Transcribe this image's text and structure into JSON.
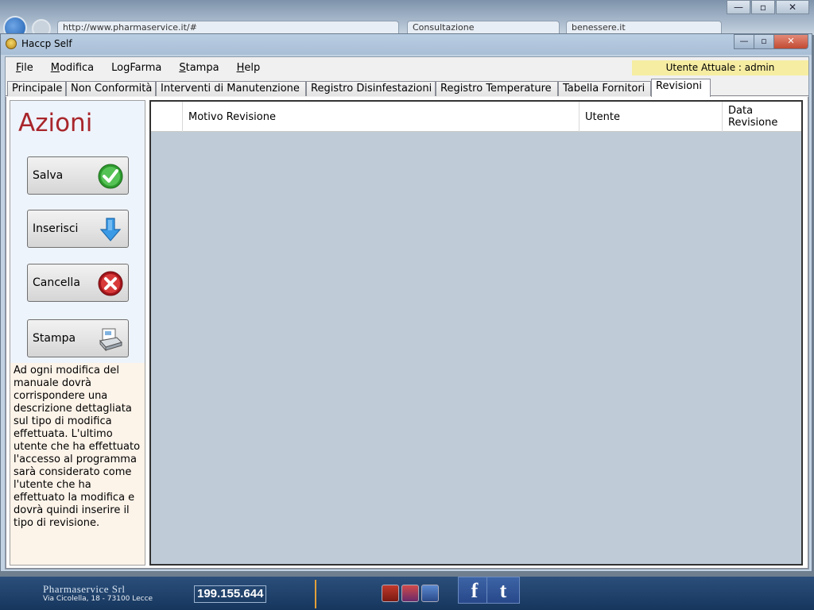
{
  "background": {
    "address_fragment": "http://www.pharmaservice.it/#",
    "tabs": [
      "Consultazione",
      "benessere.it"
    ],
    "controls": [
      "—",
      "▫",
      "✕"
    ]
  },
  "window": {
    "title": "Haccp Self",
    "controls": {
      "minimize": "—",
      "maximize": "▫",
      "close": "✕"
    }
  },
  "menu": {
    "items": [
      {
        "label": "File",
        "mnemonic": "F",
        "rest": "ile"
      },
      {
        "label": "Modifica",
        "mnemonic": "M",
        "rest": "odifica"
      },
      {
        "label": "LogFarma",
        "mnemonic": "",
        "rest": "LogFarma"
      },
      {
        "label": "Stampa",
        "mnemonic": "S",
        "rest": "tampa"
      },
      {
        "label": "Help",
        "mnemonic": "H",
        "rest": "elp"
      }
    ],
    "user_label": "Utente Attuale : admin"
  },
  "tabs": [
    {
      "label": "Principale",
      "active": false
    },
    {
      "label": "Non Conformità",
      "active": false
    },
    {
      "label": "Interventi di Manutenzione",
      "active": false
    },
    {
      "label": "Registro Disinfestazioni",
      "active": false
    },
    {
      "label": "Registro Temperature",
      "active": false
    },
    {
      "label": "Tabella Fornitori",
      "active": false
    },
    {
      "label": "Revisioni",
      "active": true
    }
  ],
  "sidebar": {
    "title": "Azioni",
    "buttons": [
      {
        "label": "Salva",
        "icon": "checkmark-icon"
      },
      {
        "label": "Inserisci",
        "icon": "arrow-down-icon"
      },
      {
        "label": "Cancella",
        "icon": "delete-x-icon"
      },
      {
        "label": "Stampa",
        "icon": "printer-icon"
      }
    ],
    "info": "Ad ogni modifica del manuale dovrà corrispondere una descrizione dettagliata sul tipo di modifica effettuata. L'ultimo utente che ha effettuato l'accesso al programma sarà considerato come l'utente che ha effettuato la modifica e dovrà quindi inserire il tipo di revisione."
  },
  "grid": {
    "columns": [
      "Motivo Revisione",
      "Utente",
      "Data Revisione"
    ],
    "rows": []
  },
  "footer": {
    "brand": "Pharmaservice Srl",
    "address": "Via Cicolella, 18 - 73100 Lecce",
    "phone": "199.155.644",
    "social": [
      "f",
      "t"
    ]
  },
  "colors": {
    "accent_title": "#a8262b",
    "user_badge": "#f6eda2",
    "grid_background": "#bfccd8",
    "info_background": "#fcf3e9",
    "footer": "#1f4470"
  }
}
